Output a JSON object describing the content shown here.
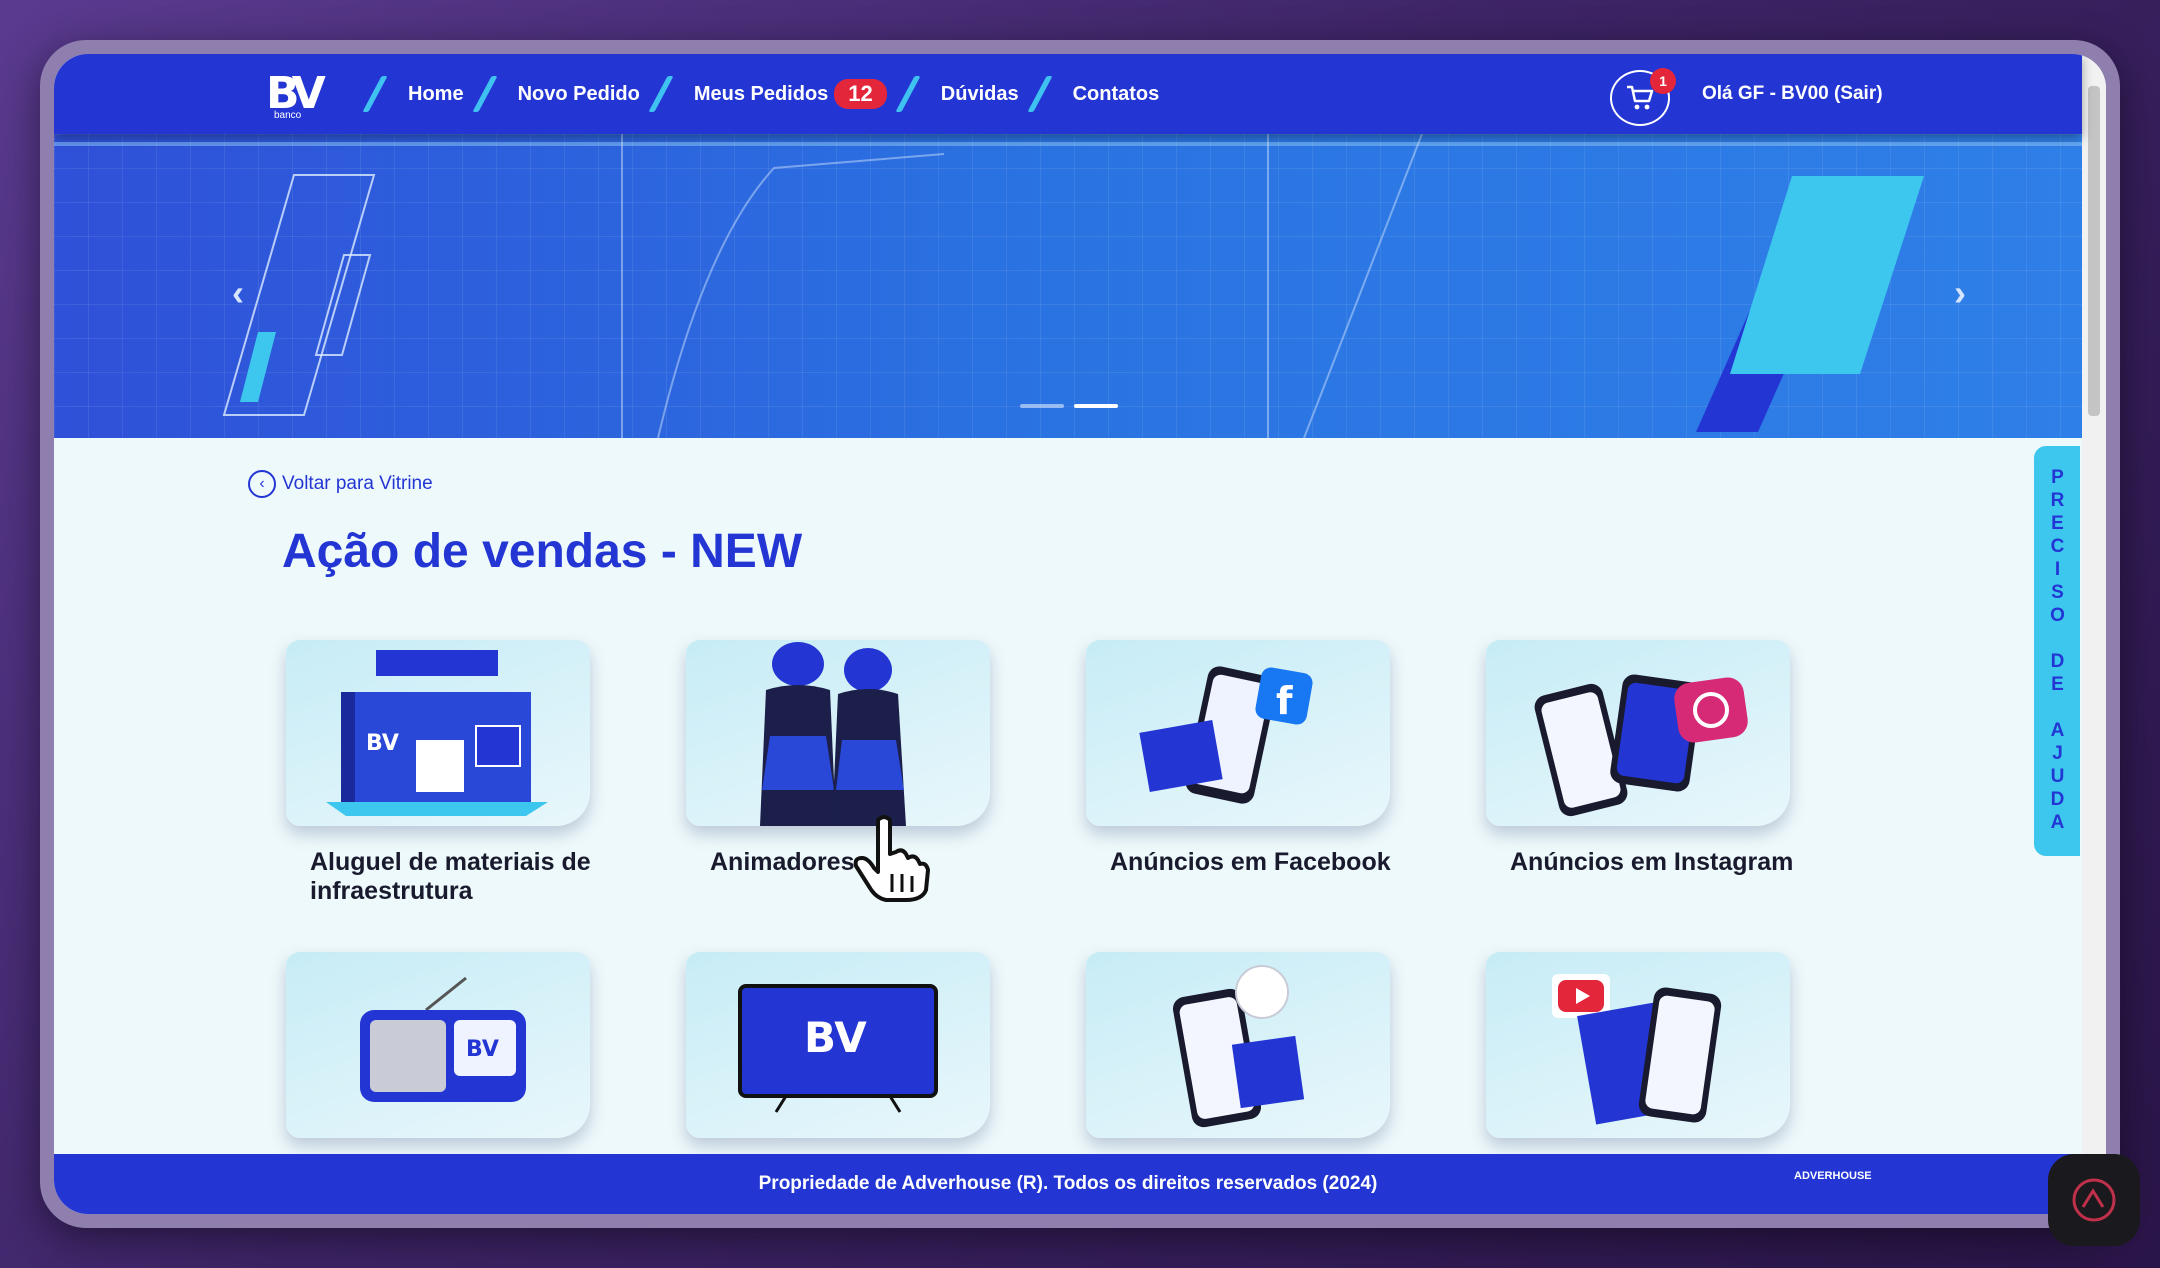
{
  "nav": {
    "logo_text": "BV",
    "logo_sub": "banco",
    "links": [
      {
        "label": "Home"
      },
      {
        "label": "Novo Pedido"
      },
      {
        "label": "Meus Pedidos",
        "badge": "12"
      },
      {
        "label": "Dúvidas"
      },
      {
        "label": "Contatos"
      }
    ],
    "cart_count": "1",
    "greeting": "Olá GF - BV00 (Sair)"
  },
  "hero": {
    "prev_arrow": "‹",
    "next_arrow": "›",
    "slides": 2,
    "active_slide": 2
  },
  "page": {
    "back_label": "Voltar para Vitrine",
    "title": "Ação de vendas - NEW"
  },
  "products": [
    {
      "label": "Aluguel de materiais de infraestrutura",
      "icon": "stand-image"
    },
    {
      "label": "Animadores",
      "icon": "animators-image"
    },
    {
      "label": "Anúncios em Facebook",
      "icon": "facebook-ads-image"
    },
    {
      "label": "Anúncios em Instagram",
      "icon": "instagram-ads-image"
    },
    {
      "label": "",
      "icon": "radio-image"
    },
    {
      "label": "",
      "icon": "tv-image"
    },
    {
      "label": "",
      "icon": "phone-image"
    },
    {
      "label": "",
      "icon": "youtube-image"
    }
  ],
  "help_tab": "PRECISO DE AJUDA",
  "footer": {
    "text": "Propriedade de Adverhouse (R). Todos os direitos reservados (2024)",
    "logo_text": "ADVERHOUSE"
  },
  "colors": {
    "brand_blue": "#2336d4",
    "accent_cyan": "#3ec7ee",
    "badge_red": "#e3263a"
  }
}
